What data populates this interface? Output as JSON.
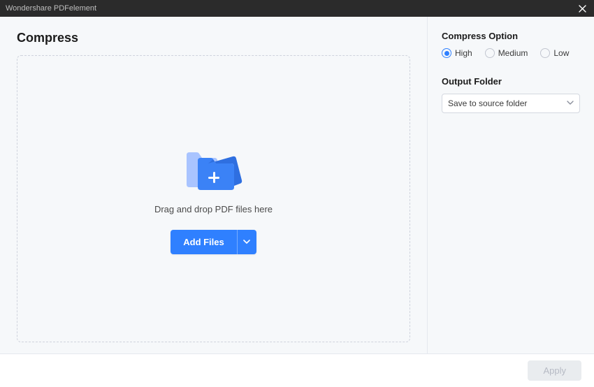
{
  "titlebar": {
    "title": "Wondershare PDFelement"
  },
  "page": {
    "title": "Compress"
  },
  "dropzone": {
    "text": "Drag and drop PDF files here",
    "add_button_label": "Add Files"
  },
  "options": {
    "compress_heading": "Compress Option",
    "levels": {
      "high": "High",
      "medium": "Medium",
      "low": "Low"
    },
    "selected": "high",
    "output_heading": "Output Folder",
    "output_value": "Save to source folder"
  },
  "footer": {
    "apply_label": "Apply"
  }
}
